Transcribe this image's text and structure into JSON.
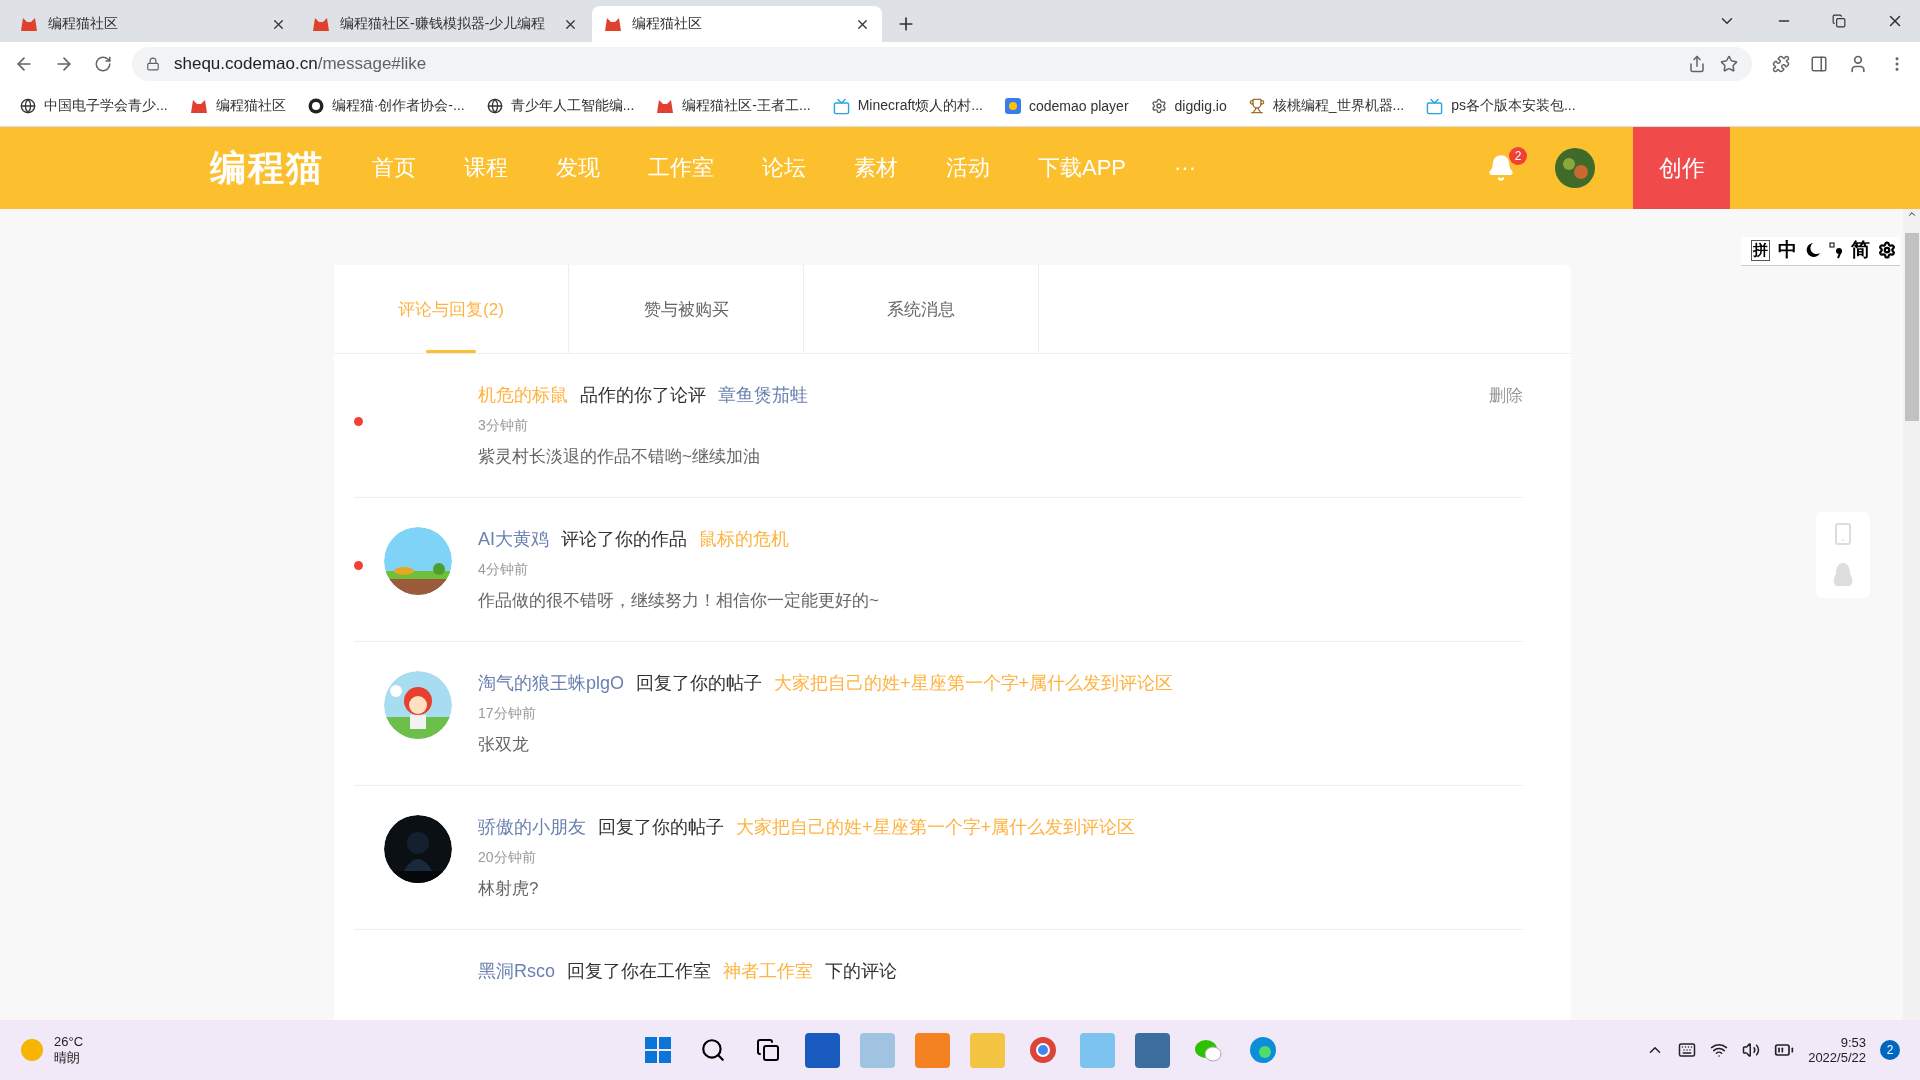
{
  "browser": {
    "tabs": [
      {
        "title": "编程猫社区",
        "selected": false
      },
      {
        "title": "编程猫社区-赚钱模拟器-少儿编程",
        "selected": false
      },
      {
        "title": "编程猫社区",
        "selected": true
      }
    ],
    "url_host": "shequ.codemao.cn",
    "url_path": "/message#like",
    "bookmarks": [
      {
        "label": "中国电子学会青少...",
        "kind": "globe"
      },
      {
        "label": "编程猫社区",
        "kind": "cat"
      },
      {
        "label": "编程猫·创作者协会-...",
        "kind": "badge"
      },
      {
        "label": "青少年人工智能编...",
        "kind": "globe"
      },
      {
        "label": "编程猫社区-王者工...",
        "kind": "cat"
      },
      {
        "label": "Minecraft烦人的村...",
        "kind": "tv"
      },
      {
        "label": "codemao player",
        "kind": "app"
      },
      {
        "label": "digdig.io",
        "kind": "gear"
      },
      {
        "label": "核桃编程_世界机器...",
        "kind": "trophy"
      },
      {
        "label": "ps各个版本安装包...",
        "kind": "tv"
      }
    ]
  },
  "header": {
    "logo": "编程猫",
    "nav": [
      "首页",
      "课程",
      "发现",
      "工作室",
      "论坛",
      "素材",
      "活动",
      "下载APP"
    ],
    "more": "···",
    "notifications": "2",
    "create": "创作"
  },
  "ime_toolbar": [
    "拼",
    "中",
    "简"
  ],
  "message_tabs": [
    {
      "label": "评论与回复(2)",
      "selected": true
    },
    {
      "label": "赞与被购买",
      "selected": false
    },
    {
      "label": "系统消息",
      "selected": false
    }
  ],
  "messages": [
    {
      "unread": true,
      "parts": [
        {
          "text": "机危的标鼠",
          "color": "#ffb23f"
        },
        {
          "text": "品作的你了论评",
          "color": "#333333"
        },
        {
          "text": "章鱼煲茄蛙",
          "color": "#6a80b0"
        }
      ],
      "time": "3分钟前",
      "content": "紫灵村长淡退的作品不错哟~继续加油",
      "delete": "删除"
    },
    {
      "unread": true,
      "avatar": {
        "kind": "picture"
      },
      "parts": [
        {
          "text": "AI大黄鸡",
          "color": "#6a80b0"
        },
        {
          "text": "评论了你的作品",
          "color": "#333333"
        },
        {
          "text": "鼠标的危机",
          "color": "#ffb23f"
        }
      ],
      "time": "4分钟前",
      "content": "作品做的很不错呀，继续努力！相信你一定能更好的~"
    },
    {
      "unread": false,
      "avatar": {
        "kind": "picture"
      },
      "parts": [
        {
          "text": "淘气的狼王蛛plgO",
          "color": "#6a80b0"
        },
        {
          "text": "回复了你的帖子",
          "color": "#333333"
        },
        {
          "text": "大家把自己的姓+星座第一个字+属什么发到评论区",
          "color": "#ffb23f"
        }
      ],
      "time": "17分钟前",
      "content": "张双龙"
    },
    {
      "unread": false,
      "avatar": {
        "kind": "picture"
      },
      "parts": [
        {
          "text": "骄傲的小朋友",
          "color": "#6a80b0"
        },
        {
          "text": "回复了你的帖子",
          "color": "#333333"
        },
        {
          "text": "大家把自己的姓+星座第一个字+属什么发到评论区",
          "color": "#ffb23f"
        }
      ],
      "time": "20分钟前",
      "content": "林射虎?"
    },
    {
      "unread": false,
      "parts": [
        {
          "text": "黑洞Rsco",
          "color": "#6a80b0"
        },
        {
          "text": "回复了你在工作室",
          "color": "#333333"
        },
        {
          "text": "神者工作室",
          "color": "#ffb23f"
        },
        {
          "text": "下的评论",
          "color": "#333333"
        }
      ]
    }
  ],
  "taskbar": {
    "temperature": "26°C",
    "weather": "晴朗",
    "time": "9:53",
    "date": "2022/5/22",
    "notifications": "2"
  }
}
